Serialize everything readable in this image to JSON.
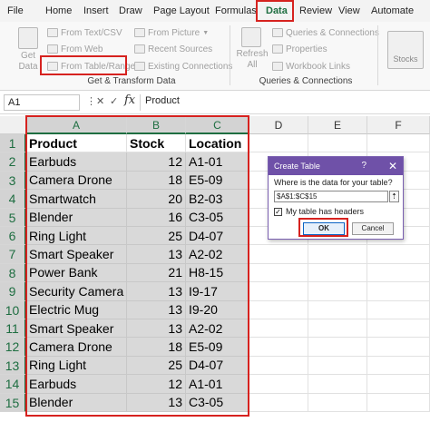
{
  "ribbon": {
    "tabs": [
      "File",
      "Home",
      "Insert",
      "Draw",
      "Page Layout",
      "Formulas",
      "Data",
      "Review",
      "View",
      "Automate"
    ],
    "active_tab": "Data",
    "get_data": "Get\nData",
    "get_data_line1": "Get",
    "get_data_line2": "Data",
    "from_text_csv": "From Text/CSV",
    "from_web": "From Web",
    "from_table_range": "From Table/Range",
    "from_picture": "From Picture",
    "recent_sources": "Recent Sources",
    "existing_connections": "Existing Connections",
    "refresh_line1": "Refresh",
    "refresh_line2": "All",
    "queries_connections": "Queries & Connections",
    "properties": "Properties",
    "workbook_links": "Workbook Links",
    "stocks": "Stocks",
    "group_get_transform": "Get & Transform Data",
    "group_queries": "Queries & Connections"
  },
  "formula_bar": {
    "name_box": "A1",
    "fx": "fx",
    "value": "Product"
  },
  "grid": {
    "columns": [
      "A",
      "B",
      "C",
      "D",
      "E",
      "F"
    ],
    "rows": [
      "1",
      "2",
      "3",
      "4",
      "5",
      "6",
      "7",
      "8",
      "9",
      "10",
      "11",
      "12",
      "13",
      "14",
      "15"
    ],
    "headers": [
      "Product",
      "Stock",
      "Location"
    ],
    "data": [
      [
        "Earbuds",
        "12",
        "A1-01"
      ],
      [
        "Camera Drone",
        "18",
        "E5-09"
      ],
      [
        "Smartwatch",
        "20",
        "B2-03"
      ],
      [
        "Blender",
        "16",
        "C3-05"
      ],
      [
        "Ring Light",
        "25",
        "D4-07"
      ],
      [
        "Smart Speaker",
        "13",
        "A2-02"
      ],
      [
        "Power Bank",
        "21",
        "H8-15"
      ],
      [
        "Security Camera",
        "13",
        "I9-17"
      ],
      [
        "Electric Mug",
        "13",
        "I9-20"
      ],
      [
        "Smart Speaker",
        "13",
        "A2-02"
      ],
      [
        "Camera Drone",
        "18",
        "E5-09"
      ],
      [
        "Ring Light",
        "25",
        "D4-07"
      ],
      [
        "Earbuds",
        "12",
        "A1-01"
      ],
      [
        "Blender",
        "13",
        "C3-05"
      ]
    ]
  },
  "dialog": {
    "title": "Create Table",
    "help": "?",
    "close": "✕",
    "question": "Where is the data for your table?",
    "range": "$A$1:$C$15",
    "range_btn": "⇡",
    "has_headers": "My table has headers",
    "check": "✓",
    "ok": "OK",
    "cancel": "Cancel"
  },
  "colors": {
    "accent_green": "#1e6e41",
    "highlight_red": "#d6221f",
    "dialog_purple": "#6f51a8"
  }
}
